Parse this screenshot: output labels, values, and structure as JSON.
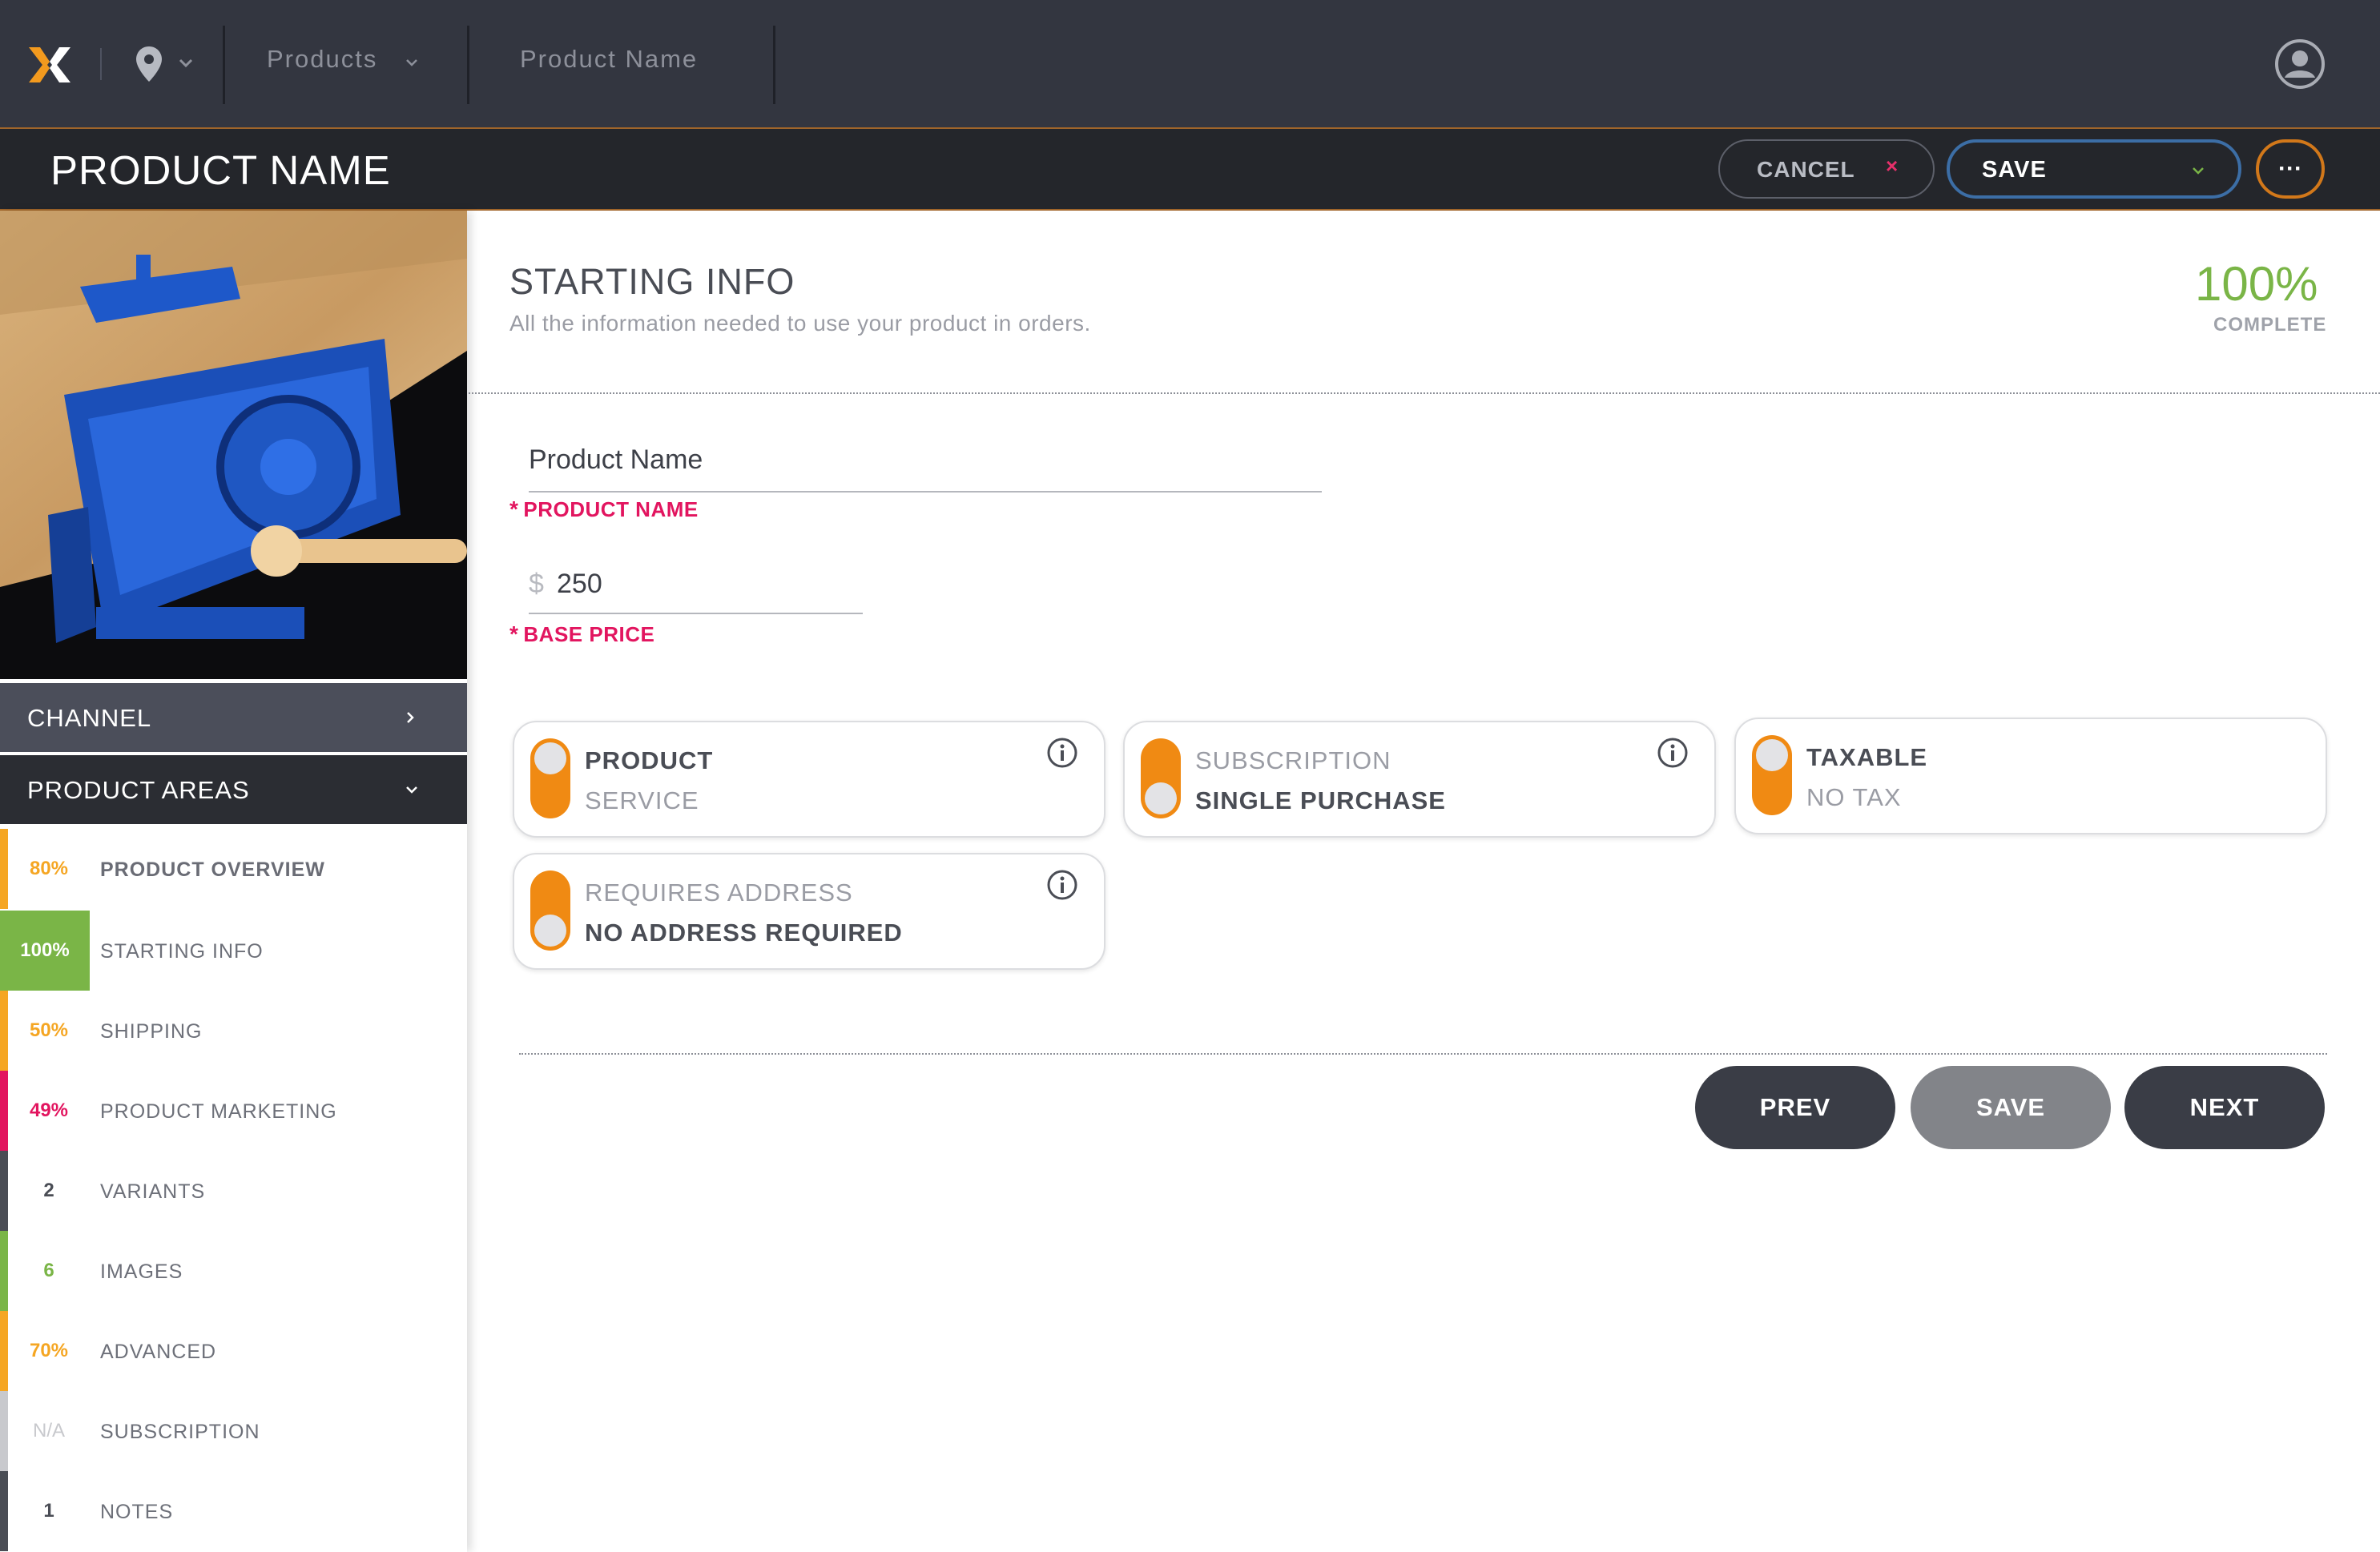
{
  "topnav": {
    "breadcrumb_products": "Products",
    "breadcrumb_product_name": "Product Name",
    "icons": [
      "logo-icon",
      "location-pin-icon",
      "chevron-down-icon",
      "user-icon"
    ],
    "logo_colors": [
      "#f39a1e",
      "#ffffff"
    ]
  },
  "titlebar": {
    "title": "PRODUCT NAME",
    "cancel_label": "CANCEL",
    "cancel_icon": "×",
    "save_label": "SAVE",
    "more_label": "···"
  },
  "sidebar": {
    "image_alt": "blue woodworking vise mounted on a bench",
    "channel_label": "CHANNEL",
    "areas_label": "PRODUCT AREAS",
    "items": [
      {
        "pct": "80%",
        "label": "PRODUCT OVERVIEW",
        "color": "#f5a623"
      },
      {
        "pct": "100%",
        "label": "STARTING INFO",
        "color": "#7ab547"
      },
      {
        "pct": "50%",
        "label": "SHIPPING",
        "color": "#f5a623"
      },
      {
        "pct": "49%",
        "label": "PRODUCT MARKETING",
        "color": "#e2155f"
      },
      {
        "pct": "2",
        "label": "VARIANTS",
        "color": "#4a4d55"
      },
      {
        "pct": "6",
        "label": "IMAGES",
        "color": "#7ab547"
      },
      {
        "pct": "70%",
        "label": "ADVANCED",
        "color": "#f5a623"
      },
      {
        "pct": "N/A",
        "label": "SUBSCRIPTION",
        "color": "#c8c9cd"
      },
      {
        "pct": "1",
        "label": "NOTES",
        "color": "#4a4d55"
      }
    ]
  },
  "main": {
    "title": "STARTING INFO",
    "subtitle": "All the information needed to use your product in orders.",
    "complete_pct": "100%",
    "complete_label": "COMPLETE",
    "product_name_value": "Product Name",
    "product_name_label": "PRODUCT NAME",
    "currency_symbol": "$",
    "base_price_value": "250",
    "base_price_label": "BASE PRICE",
    "required_mark": "*",
    "toggles": [
      {
        "option_a": "PRODUCT",
        "option_b": "SERVICE",
        "selected": "option_a"
      },
      {
        "option_a": "SUBSCRIPTION",
        "option_b": "SINGLE PURCHASE",
        "selected": "option_b"
      },
      {
        "option_a": "TAXABLE",
        "option_b": "NO TAX",
        "selected": "option_a"
      },
      {
        "option_a": "REQUIRES ADDRESS",
        "option_b": "NO ADDRESS REQUIRED",
        "selected": "option_b"
      }
    ],
    "toggle_color": "#f08a13",
    "prev_label": "PREV",
    "save_label": "SAVE",
    "next_label": "NEXT"
  }
}
